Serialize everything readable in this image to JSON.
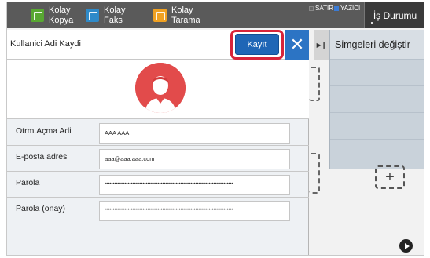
{
  "topbar": {
    "tiles": [
      {
        "line1": "Kolay",
        "line2": "Kopya",
        "icon": "copy-icon"
      },
      {
        "line1": "Kolay",
        "line2": "Faks",
        "icon": "fax-icon"
      },
      {
        "line1": "Kolay",
        "line2": "Tarama",
        "icon": "scan-icon"
      }
    ],
    "legend_satir": "SATIR",
    "legend_yazici": "YAZICI",
    "job_status": "İş Durumu"
  },
  "dialog": {
    "title": "Kullanici Adi Kaydi",
    "save_label": "Kayıt",
    "close_symbol": "✕",
    "fields": [
      {
        "label": "Otrm.Açma Adi",
        "value": "AAA AAA"
      },
      {
        "label": "E-posta adresi",
        "value": "aaa@aaa.aaa.com"
      },
      {
        "label": "Parola",
        "value": "••••••••••••••••••••••••••••••••••••••••••••••••••••••••••••••••••••••••••••••"
      },
      {
        "label": "Parola (onay)",
        "value": "••••••••••••••••••••••••••••••••••••••••••••••••••••••••••••••••••••••••••••••"
      }
    ]
  },
  "side_panel": {
    "title": "Simgeleri değiştir",
    "plus_symbol": "+"
  },
  "colors": {
    "accent_blue": "#1f66b6",
    "highlight_red": "#d8243a",
    "avatar_red": "#e24b4b",
    "topbar": "#5a5a5a"
  }
}
